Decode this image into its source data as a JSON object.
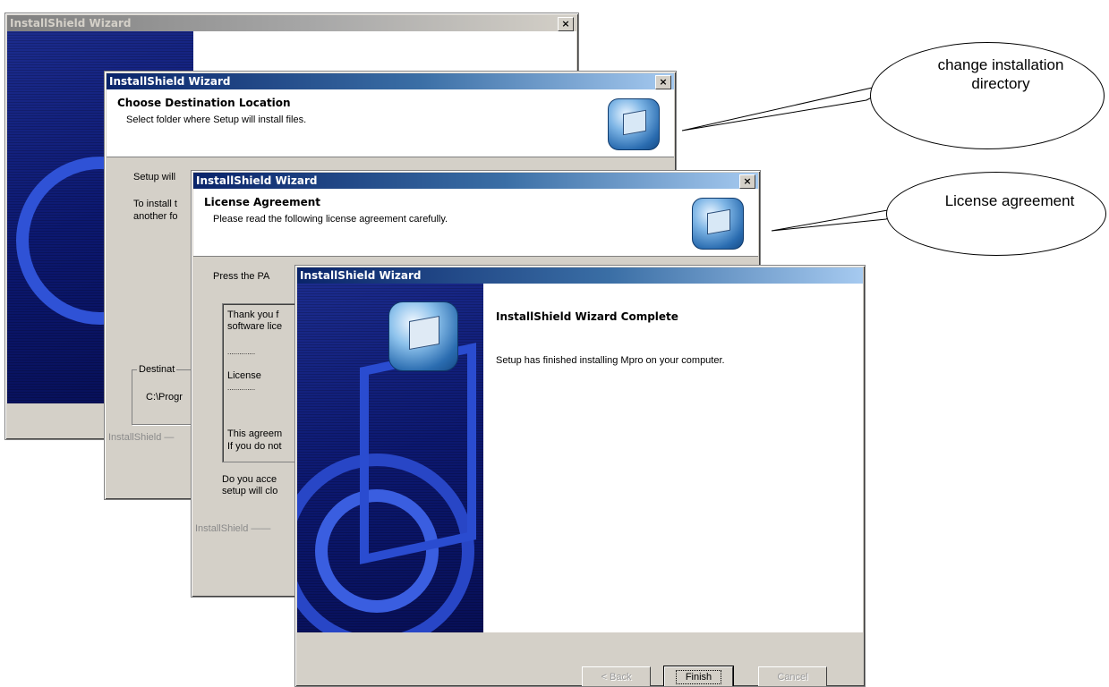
{
  "window1": {
    "title": "InstallShield Wizard",
    "close": "×"
  },
  "window2": {
    "title": "InstallShield Wizard",
    "close": "×",
    "header_title": "Choose Destination Location",
    "header_sub": "Select folder where Setup will install files.",
    "line1": "Setup will",
    "line2": "To install t",
    "line3": "another fo",
    "group_label": "Destinat",
    "path": "C:\\Progr",
    "brand": "InstallShield —"
  },
  "window3": {
    "title": "InstallShield Wizard",
    "close": "×",
    "header_title": "License Agreement",
    "header_sub": "Please read the following license agreement carefully.",
    "press": "Press the PA",
    "lic_line1": "Thank you f",
    "lic_line2": "software lice",
    "lic_dots1": "..............",
    "lic_license": "License",
    "lic_dots2": "..............",
    "lic_line3": "This agreem",
    "lic_line4": "If you do not",
    "q1": "Do you acce",
    "q2": "setup will clo",
    "brand": "InstallShield ——"
  },
  "window4": {
    "title": "InstallShield Wizard",
    "heading": "InstallShield Wizard Complete",
    "message": "Setup has finished installing Mpro on your computer.",
    "back": "< Back",
    "finish": "Finish",
    "cancel": "Cancel"
  },
  "callouts": {
    "directory": "change installation directory",
    "license": "License agreement"
  }
}
